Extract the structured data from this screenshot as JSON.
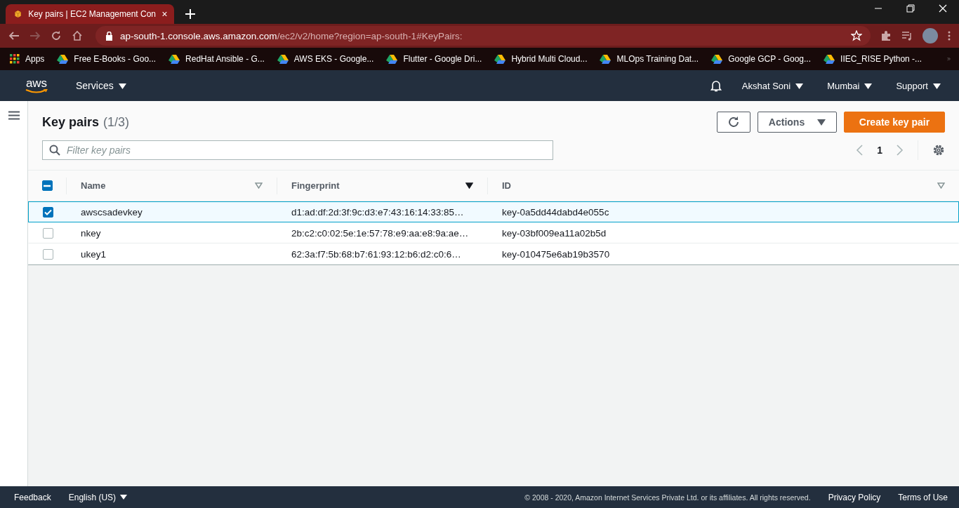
{
  "browser": {
    "tab": {
      "title": "Key pairs | EC2 Management Con"
    },
    "address": {
      "host": "ap-south-1.console.aws.amazon.com",
      "path": "/ec2/v2/home?region=ap-south-1#KeyPairs:"
    },
    "bookmarks": [
      {
        "label": "Apps",
        "kind": "apps"
      },
      {
        "label": "Free E-Books - Goo...",
        "kind": "drive"
      },
      {
        "label": "RedHat Ansible - G...",
        "kind": "drive"
      },
      {
        "label": "AWS EKS - Google...",
        "kind": "drive"
      },
      {
        "label": "Flutter - Google Dri...",
        "kind": "drive"
      },
      {
        "label": "Hybrid Multi Cloud...",
        "kind": "drive"
      },
      {
        "label": "MLOps Training Dat...",
        "kind": "drive"
      },
      {
        "label": "Google GCP - Goog...",
        "kind": "drive"
      },
      {
        "label": "IIEC_RISE Python -...",
        "kind": "drive"
      }
    ]
  },
  "topnav": {
    "logo": "aws",
    "services": "Services",
    "user": "Akshat Soni",
    "region": "Mumbai",
    "support": "Support"
  },
  "panel": {
    "title": "Key pairs",
    "count": "(1/3)",
    "actions": "Actions",
    "create": "Create key pair",
    "filter_placeholder": "Filter key pairs",
    "page": "1",
    "select_all_indeterminate": true
  },
  "table": {
    "columns": [
      {
        "label": "Name",
        "sorted": false
      },
      {
        "label": "Fingerprint",
        "sorted": true
      },
      {
        "label": "ID",
        "sorted": false
      }
    ],
    "rows": [
      {
        "name": "awscsadevkey",
        "fingerprint": "d1:ad:df:2d:3f:9c:d3:e7:43:16:14:33:85…",
        "id": "key-0a5dd44dabd4e055c",
        "selected": true
      },
      {
        "name": "nkey",
        "fingerprint": "2b:c2:c0:02:5e:1e:57:78:e9:aa:e8:9a:ae…",
        "id": "key-03bf009ea11a02b5d",
        "selected": false
      },
      {
        "name": "ukey1",
        "fingerprint": "62:3a:f7:5b:68:b7:61:93:12:b6:d2:c0:6…",
        "id": "key-010475e6ab19b3570",
        "selected": false
      }
    ]
  },
  "footer": {
    "feedback": "Feedback",
    "language": "English (US)",
    "copyright": "© 2008 - 2020, Amazon Internet Services Private Ltd. or its affiliates. All rights reserved.",
    "privacy": "Privacy Policy",
    "terms": "Terms of Use"
  }
}
